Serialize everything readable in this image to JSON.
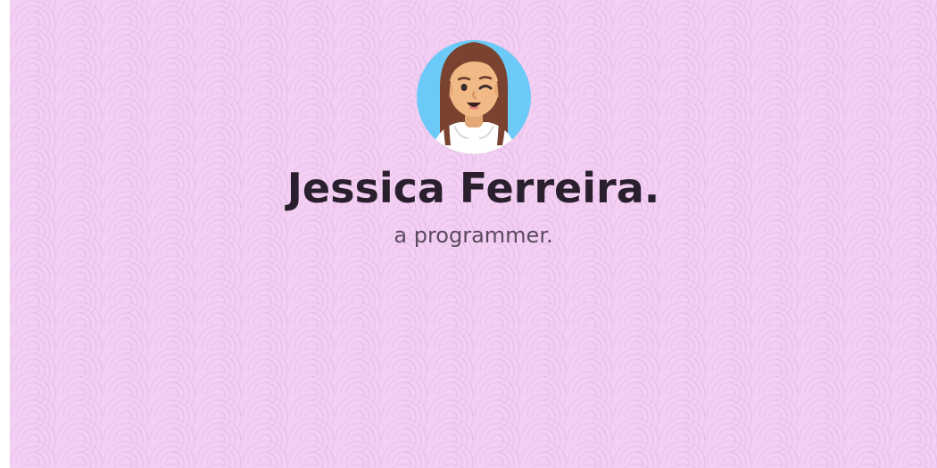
{
  "profile": {
    "name": "Jessica Ferreira.",
    "tagline": "a programmer."
  },
  "colors": {
    "background": "#f3cff3",
    "name_text": "#2a1f2c",
    "tagline_text": "#5a4a5e",
    "avatar_circle": "#6ccaf8"
  },
  "icons": {
    "avatar": "winking-girl-avatar"
  }
}
